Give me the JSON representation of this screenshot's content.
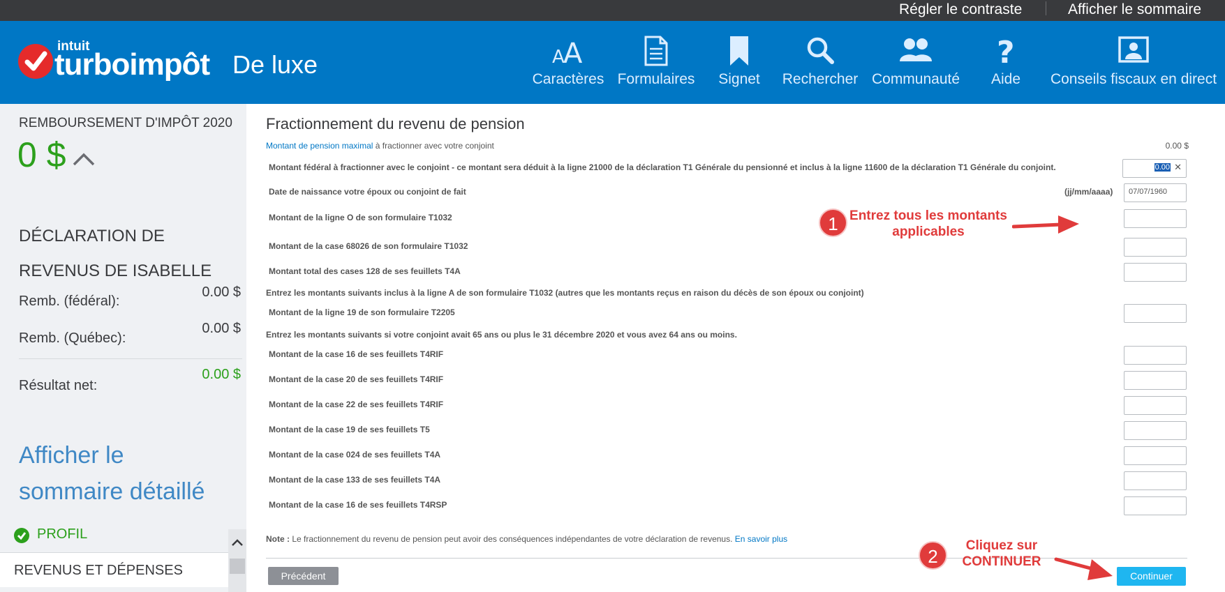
{
  "topbar": {
    "contrast": "Régler le contraste",
    "summary": "Afficher le sommaire"
  },
  "header": {
    "logo_intuit": "intuit",
    "logo_brand": "turboimpôt",
    "edition": "De luxe",
    "nav": [
      {
        "label": "Caractères",
        "icon": "font-size-icon"
      },
      {
        "label": "Formulaires",
        "icon": "document-icon"
      },
      {
        "label": "Signet",
        "icon": "bookmark-icon"
      },
      {
        "label": "Rechercher",
        "icon": "search-icon"
      },
      {
        "label": "Communauté",
        "icon": "community-icon"
      },
      {
        "label": "Aide",
        "icon": "help-icon"
      },
      {
        "label": "Conseils fiscaux en direct",
        "icon": "live-advice-icon"
      }
    ]
  },
  "sidebar": {
    "refund_title": "REMBOURSEMENT D'IMPÔT 2020",
    "refund_amount": "0 $",
    "declaration_title": "DÉCLARATION DE REVENUS DE ISABELLE",
    "federal_label": "Remb. (fédéral):",
    "federal_value": "0.00 $",
    "quebec_label": "Remb. (Québec):",
    "quebec_value": "0.00 $",
    "net_label": "Résultat net:",
    "net_value": "0.00 $",
    "summary_link": "Afficher le sommaire détaillé",
    "profile_label": "PROFIL",
    "section_label": "REVENUS ET DÉPENSES"
  },
  "main": {
    "title": "Fractionnement du revenu de pension",
    "intro_link": "Montant de pension maximal",
    "intro_rest": " à fractionner avec votre conjoint",
    "intro_amount": "0.00 $",
    "federal_label": "Montant fédéral à fractionner avec le conjoint - ce montant sera déduit à la ligne 21000 de la déclaration T1 Générale du pensionné et inclus à la ligne 11600 de la déclaration T1 Générale du conjoint.",
    "federal_value": "0.00",
    "birth_label": "Date de naissance votre époux ou conjoint de fait",
    "birth_hint": "(jj/mm/aaaa)",
    "birth_value": "07/07/1960",
    "line_o_label": "Montant de la ligne O de son formulaire T1032",
    "case_68026_label": "Montant de la case 68026 de son formulaire T1032",
    "cases_128_label": "Montant total des cases 128 de ses feuillets T4A",
    "section_a_note": "Entrez les montants suivants inclus à la ligne A de son formulaire T1032 (autres que les montants reçus en raison du décès de son époux ou conjoint)",
    "line_19_label": "Montant de la ligne 19 de son formulaire T2205",
    "section_65_note": "Entrez les montants suivants si votre conjoint avait 65 ans ou plus le 31 décembre 2020 et vous avez 64 ans ou moins.",
    "t4rif_16_label": "Montant de la case 16 de ses feuillets T4RIF",
    "t4rif_20_label": "Montant de la case 20 de ses feuillets T4RIF",
    "t4rif_22_label": "Montant de la case 22 de ses feuillets T4RIF",
    "t5_19_label": "Montant de la case 19 de ses feuillets T5",
    "t4a_024_label": "Montant de la case 024 de ses feuillets T4A",
    "t4a_133_label": "Montant de la case 133 de ses feuillets T4A",
    "t4rsp_16_label": "Montant de la case 16 de ses feuillets T4RSP",
    "note_prefix": "Note :",
    "note_text": " Le fractionnement du revenu de pension peut avoir des conséquences indépendantes de votre déclaration de revenus. ",
    "note_link": "En savoir plus",
    "prev_button": "Précédent",
    "continue_button": "Continuer"
  },
  "annotations": {
    "step1_number": "1",
    "step1_text": "Entrez tous les montants applicables",
    "step2_number": "2",
    "step2_text": "Cliquez sur CONTINUER",
    "color": "#e03b3b"
  },
  "colors": {
    "header_blue": "#0077c5",
    "topbar": "#393a3d",
    "refund_green": "#2ca01c",
    "continue_blue": "#1fb6f0",
    "link_blue": "#0077c5"
  }
}
